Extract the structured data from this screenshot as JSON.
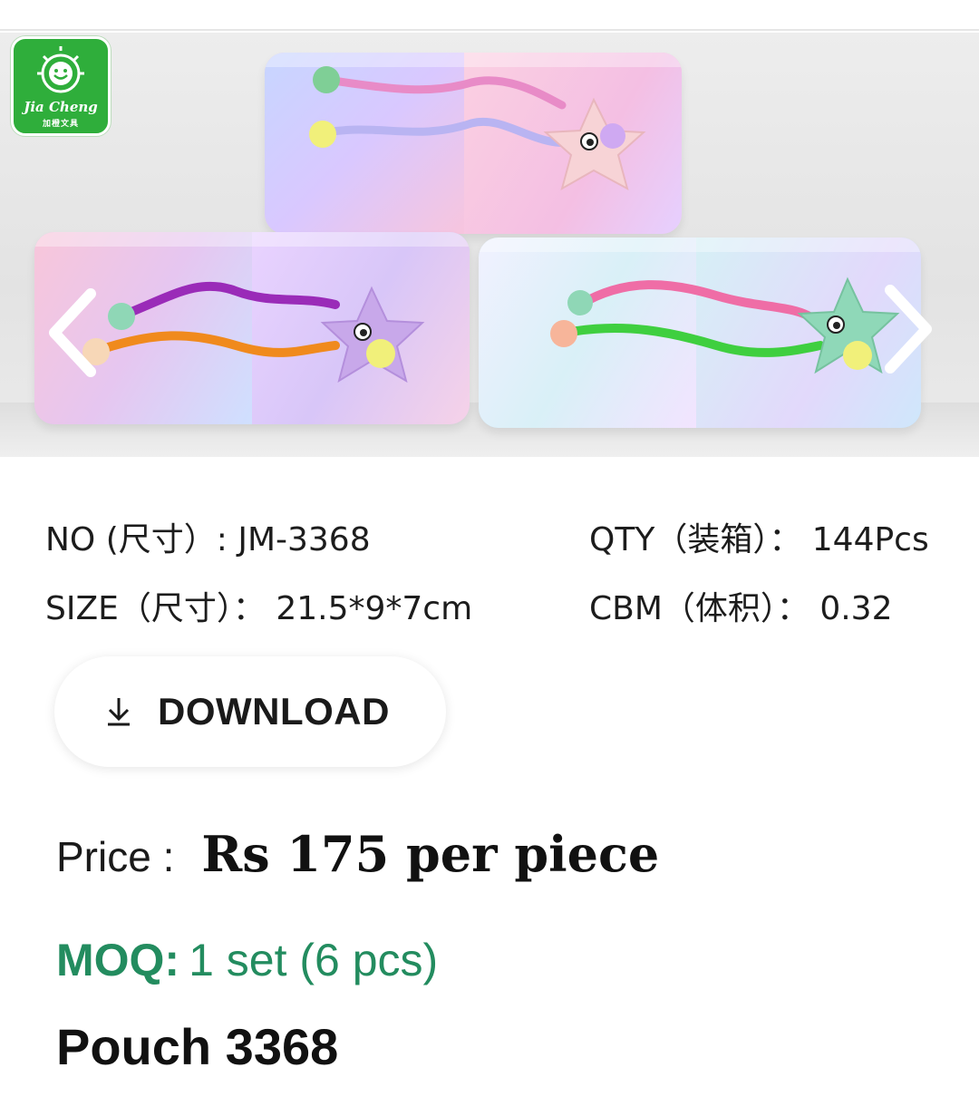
{
  "logo": {
    "brand": "Jia Cheng",
    "brand_cn": "加橙文具"
  },
  "specs": {
    "no": "NO (尺寸）: JM-3368",
    "qty": "QTY（装箱）： 144Pcs",
    "size": "SIZE（尺寸）： 21.5*9*7cm",
    "cbm": "CBM（体积）： 0.32"
  },
  "download": {
    "label": "DOWNLOAD",
    "icon": "download-icon"
  },
  "price": {
    "label": "Price :",
    "value": "Rs 175 per piece"
  },
  "moq": {
    "label": "MOQ:",
    "value": "1 set (6 pcs)"
  },
  "product": {
    "title": "Pouch 3368"
  },
  "icons": {
    "prev": "chevron-left-icon",
    "next": "chevron-right-icon"
  },
  "colors": {
    "moq_green": "#238c5f",
    "logo_green": "#2fae3b"
  }
}
